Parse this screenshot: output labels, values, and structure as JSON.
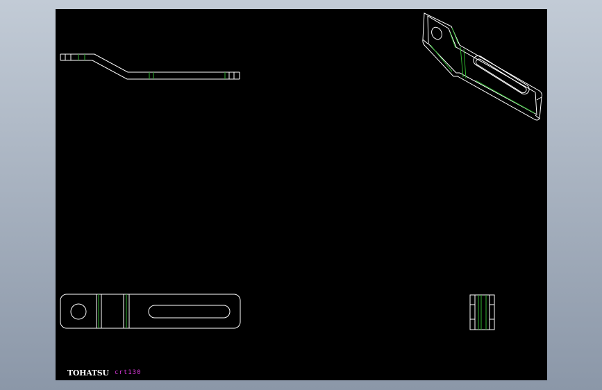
{
  "title_block": {
    "brand": "TOHATSU",
    "part_code": "crt130"
  },
  "colors": {
    "background": "#000000",
    "outline": "#ffffff",
    "hidden_edge": "#2fb52f",
    "annotation": "#d838d8"
  }
}
